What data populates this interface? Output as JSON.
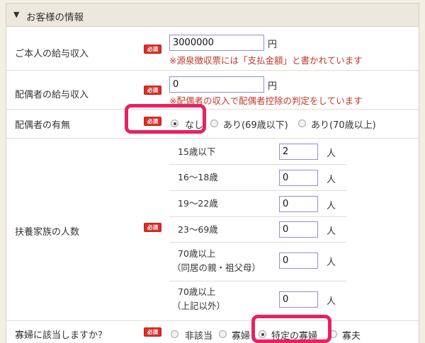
{
  "section": {
    "toggle_icon": "▼",
    "title": "お客様の情報"
  },
  "required_badge": "必須",
  "accent_color": "#e8215f",
  "salary": {
    "label": "ご本人の給与収入",
    "value": "3000000",
    "unit": "円",
    "note": "※源泉徴収票には「支払金額」と書かれています"
  },
  "spouse_salary": {
    "label": "配偶者の給与収入",
    "value": "0",
    "unit": "円",
    "note": "※配偶者の収入で配偶者控除の判定をしています"
  },
  "spouse": {
    "label": "配偶者の有無",
    "options": [
      "なし",
      "あり(69歳以下)",
      "あり(70歳以上)"
    ],
    "selected": "なし"
  },
  "dependents": {
    "label": "扶養家族の人数",
    "unit": "人",
    "rows": [
      {
        "label": "15歳以下",
        "value": "2"
      },
      {
        "label": "16〜18歳",
        "value": "0"
      },
      {
        "label": "19〜22歳",
        "value": "0"
      },
      {
        "label": "23〜69歳",
        "value": "0"
      },
      {
        "label": "70歳以上",
        "label2": "（同居の親・祖父母）",
        "value": "0"
      },
      {
        "label": "70歳以上",
        "label2": "（上記以外）",
        "value": "0"
      }
    ]
  },
  "widow": {
    "label": "寡婦に該当しますか？",
    "options": [
      "非該当",
      "寡婦",
      "特定の寡婦",
      "寡夫"
    ],
    "selected": "特定の寡婦"
  }
}
